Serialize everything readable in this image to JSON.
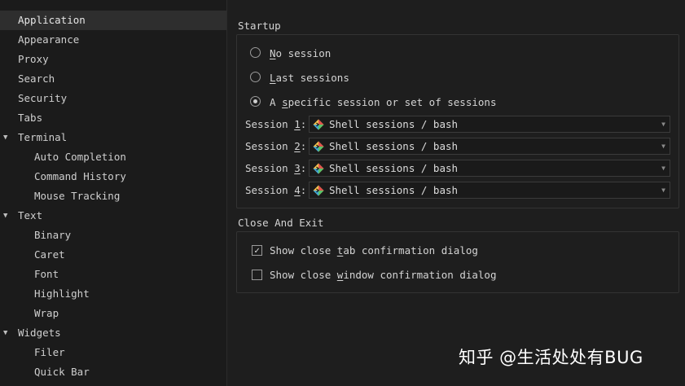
{
  "sidebar": {
    "items": [
      {
        "label": "Application",
        "indent": 0,
        "expandable": false,
        "selected": true
      },
      {
        "label": "Appearance",
        "indent": 0,
        "expandable": false,
        "selected": false
      },
      {
        "label": "Proxy",
        "indent": 0,
        "expandable": false,
        "selected": false
      },
      {
        "label": "Search",
        "indent": 0,
        "expandable": false,
        "selected": false
      },
      {
        "label": "Security",
        "indent": 0,
        "expandable": false,
        "selected": false
      },
      {
        "label": "Tabs",
        "indent": 0,
        "expandable": false,
        "selected": false
      },
      {
        "label": "Terminal",
        "indent": 0,
        "expandable": true,
        "selected": false
      },
      {
        "label": "Auto Completion",
        "indent": 1,
        "expandable": false,
        "selected": false
      },
      {
        "label": "Command History",
        "indent": 1,
        "expandable": false,
        "selected": false
      },
      {
        "label": "Mouse Tracking",
        "indent": 1,
        "expandable": false,
        "selected": false
      },
      {
        "label": "Text",
        "indent": 0,
        "expandable": true,
        "selected": false
      },
      {
        "label": "Binary",
        "indent": 1,
        "expandable": false,
        "selected": false
      },
      {
        "label": "Caret",
        "indent": 1,
        "expandable": false,
        "selected": false
      },
      {
        "label": "Font",
        "indent": 1,
        "expandable": false,
        "selected": false
      },
      {
        "label": "Highlight",
        "indent": 1,
        "expandable": false,
        "selected": false
      },
      {
        "label": "Wrap",
        "indent": 1,
        "expandable": false,
        "selected": false
      },
      {
        "label": "Widgets",
        "indent": 0,
        "expandable": true,
        "selected": false
      },
      {
        "label": "Filer",
        "indent": 1,
        "expandable": false,
        "selected": false
      },
      {
        "label": "Quick Bar",
        "indent": 1,
        "expandable": false,
        "selected": false
      }
    ]
  },
  "startup": {
    "title": "Startup",
    "options": [
      {
        "pre": "",
        "mnemonic": "N",
        "post": "o session",
        "checked": false
      },
      {
        "pre": "",
        "mnemonic": "L",
        "post": "ast sessions",
        "checked": false
      },
      {
        "pre": "A ",
        "mnemonic": "s",
        "post": "pecific session or set of sessions",
        "checked": true
      }
    ],
    "sessions": [
      {
        "label_pre": "Session ",
        "mnemonic": "1",
        "label_post": ":",
        "value": "Shell sessions / bash"
      },
      {
        "label_pre": "Session ",
        "mnemonic": "2",
        "label_post": ":",
        "value": "Shell sessions / bash"
      },
      {
        "label_pre": "Session ",
        "mnemonic": "3",
        "label_post": ":",
        "value": "Shell sessions / bash"
      },
      {
        "label_pre": "Session ",
        "mnemonic": "4",
        "label_post": ":",
        "value": "Shell sessions / bash"
      }
    ]
  },
  "close_exit": {
    "title": "Close And Exit",
    "options": [
      {
        "pre": "Show close ",
        "mnemonic": "t",
        "post": "ab confirmation dialog",
        "checked": true
      },
      {
        "pre": "Show close ",
        "mnemonic": "w",
        "post": "indow confirmation dialog",
        "checked": false
      }
    ]
  },
  "icons": {
    "session_icon": "terminal-shell-icon",
    "dropdown_icon": "chevron-down-icon",
    "tree_expand_icon": "triangle-down-icon"
  },
  "watermark": "知乎 @生活处处有BUG"
}
